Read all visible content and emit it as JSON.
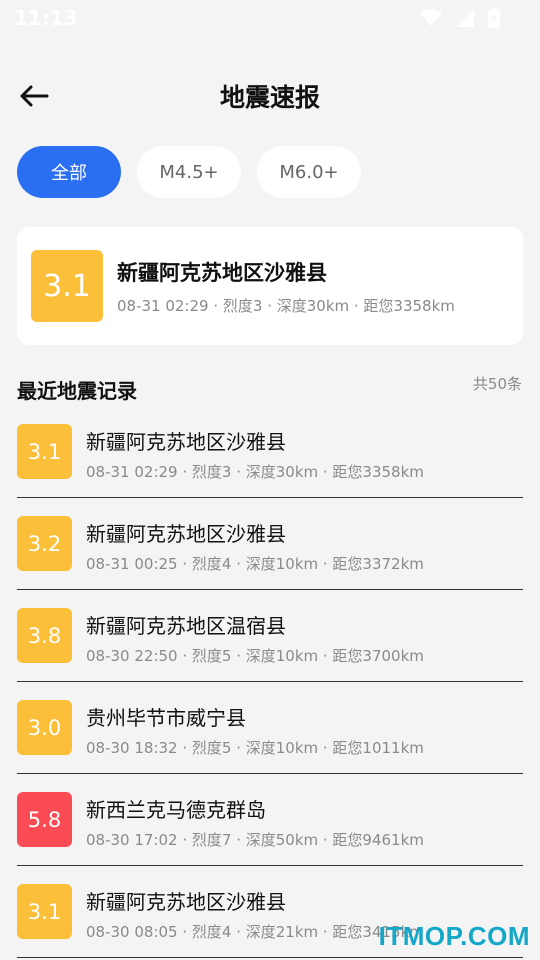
{
  "status_bar": {
    "time": "11:13"
  },
  "header": {
    "title": "地震速报"
  },
  "filters": [
    {
      "label": "全部",
      "active": true
    },
    {
      "label": "M4.5+",
      "active": false
    },
    {
      "label": "M6.0+",
      "active": false
    }
  ],
  "featured": {
    "magnitude": "3.1",
    "location": "新疆阿克苏地区沙雅县",
    "meta": "08-31 02:29 · 烈度3 · 深度30km · 距您3358km",
    "color": "#fcbf3a"
  },
  "section": {
    "title": "最近地震记录",
    "count": "共50条"
  },
  "records": [
    {
      "magnitude": "3.1",
      "location": "新疆阿克苏地区沙雅县",
      "meta": "08-31 02:29 · 烈度3 · 深度30km · 距您3358km",
      "color": "#fcbf3a"
    },
    {
      "magnitude": "3.2",
      "location": "新疆阿克苏地区沙雅县",
      "meta": "08-31 00:25 · 烈度4 · 深度10km · 距您3372km",
      "color": "#fcbf3a"
    },
    {
      "magnitude": "3.8",
      "location": "新疆阿克苏地区温宿县",
      "meta": "08-30 22:50 · 烈度5 · 深度10km · 距您3700km",
      "color": "#fcbf3a"
    },
    {
      "magnitude": "3.0",
      "location": "贵州毕节市威宁县",
      "meta": "08-30 18:32 · 烈度5 · 深度10km · 距您1011km",
      "color": "#fcbf3a"
    },
    {
      "magnitude": "5.8",
      "location": "新西兰克马德克群岛",
      "meta": "08-30 17:02 · 烈度7 · 深度50km · 距您9461km",
      "color": "#fb4b55"
    },
    {
      "magnitude": "3.1",
      "location": "新疆阿克苏地区沙雅县",
      "meta": "08-30 08:05 · 烈度4 · 深度21km · 距您3415km",
      "color": "#fcbf3a"
    }
  ],
  "watermark": "ITMOP.COM",
  "colors": {
    "accent": "#2a6ef2",
    "minor": "#fcbf3a",
    "major": "#fb4b55"
  }
}
